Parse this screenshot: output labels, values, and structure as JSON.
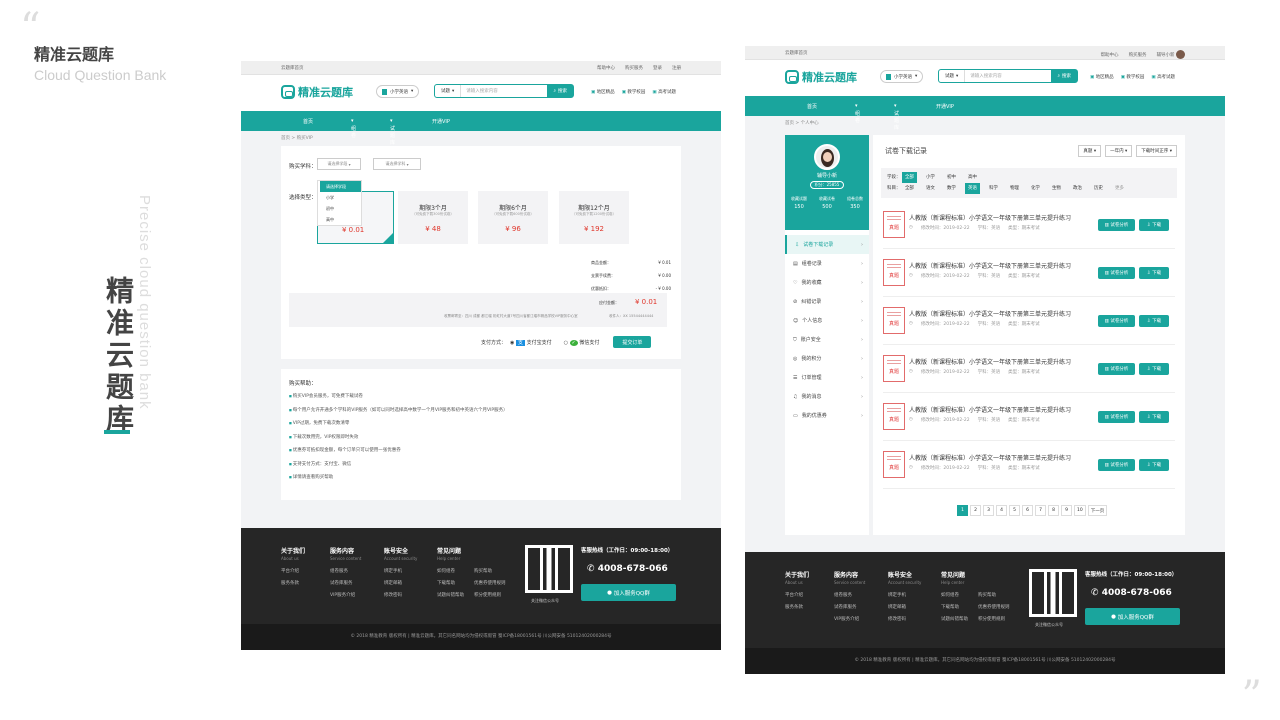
{
  "presentation": {
    "title": "精准云题库",
    "subtitle": "Cloud Question Bank",
    "vertical_en": "Precise cloud question bank",
    "vertical_cn": "精准云题库"
  },
  "page1": {
    "topbar": {
      "left": "云题库首页",
      "right": [
        "帮助中心",
        "购买服务",
        "登录",
        "注册"
      ]
    },
    "logo": "精准云题库",
    "grade_select": "小学英语",
    "search": {
      "type": "试题",
      "placeholder": "请输入搜索内容",
      "button": "搜索"
    },
    "links": [
      "地区精品",
      "教学校园",
      "高考试题"
    ],
    "nav": [
      "首页",
      "组卷",
      "试题库",
      "开通VIP"
    ],
    "crumb": "首页 > 购买VIP",
    "buy": {
      "subject_label": "购买学科：",
      "stage_placeholder": "请选择学段",
      "subject_placeholder": "请选择学科",
      "dropdown": [
        "请选择学段",
        "小学",
        "初中",
        "高中"
      ],
      "type_label": "选择类型：",
      "plans": [
        {
          "name": "期限1个月",
          "note": "",
          "price": "¥ 0.01"
        },
        {
          "name": "期限3个月",
          "note": "（可免费下载300份试卷）",
          "price": "¥ 48"
        },
        {
          "name": "期限6个月",
          "note": "（可免费下载600份试卷）",
          "price": "¥ 96"
        },
        {
          "name": "期限12个月",
          "note": "（可免费下载1200份试卷）",
          "price": "¥ 192"
        }
      ],
      "summary": [
        {
          "k": "商品金额：",
          "v": "¥ 0.01"
        },
        {
          "k": "支票手续费：",
          "v": "¥ 0.00"
        },
        {
          "k": "优惠抵扣：",
          "v": "- ¥ 0.00"
        }
      ],
      "pay_total_label": "应付金额：",
      "pay_total": "¥ 0.01",
      "address": "收票邮寄至：四川 成都 都江堰 彩虹村大道7号四川省都江堰市精品学校VIP服务中心室",
      "receiver": "收件人：XX  15544444444",
      "pay_method_label": "支付方式：",
      "alipay": "支付宝支付",
      "wechat": "微信支付",
      "submit": "提交订单"
    },
    "help": {
      "title": "购买帮助：",
      "items": [
        "购买VIP会员服务，可免费下载试卷",
        "每个用户允许开通多个学科的VIP服务（如可以同时选择高中数学一个月VIP服务和初中英语六个月VIP服务）",
        "VIP过期，免费下载次数清零",
        "下载次数用完，VIP权限即时失效",
        "优惠券可抵扣现金额，每个订单只可以使用一张优惠券",
        "支持支付方式：支付宝、微信",
        "详情请查看购买帮助"
      ]
    }
  },
  "page2": {
    "topbar": {
      "left": "云题库首页",
      "right": [
        "帮助中心",
        "购买服务",
        "辅导小新"
      ]
    },
    "crumb": "首页 > 个人中心",
    "profile": {
      "name": "辅导小新",
      "points": "积分：25855",
      "stats": [
        {
          "k": "收藏试题",
          "v": "150"
        },
        {
          "k": "收藏试卷",
          "v": "500"
        },
        {
          "k": "组卷总数",
          "v": "350"
        }
      ]
    },
    "menu": [
      "试卷下载记录",
      "组卷记录",
      "我的收藏",
      "纠错记录",
      "个人信息",
      "账户安全",
      "我的积分",
      "订单管理",
      "我的消息",
      "我的优惠券"
    ],
    "panel_title": "试卷下载记录",
    "sorts": [
      "真题",
      "一年内",
      "下载时间正序"
    ],
    "filter_stage_label": "学段：",
    "stages": [
      "全部",
      "小学",
      "初中",
      "高中"
    ],
    "filter_subject_label": "科目：",
    "subjects": [
      "全部",
      "语文",
      "数学",
      "英语",
      "科学",
      "物理",
      "化学",
      "生物",
      "政治",
      "历史",
      "更多"
    ],
    "item": {
      "title": "人教版（新课程标准）小学语文一年级下册第三单元提升练习",
      "date": "修改时间：2019-02-22",
      "subject": "学科：英语",
      "type": "类型：期末考试",
      "btn_analyze": "试卷分析",
      "btn_download": "下载",
      "badge": "真题"
    },
    "pages": [
      "1",
      "2",
      "3",
      "4",
      "5",
      "6",
      "7",
      "8",
      "9",
      "10",
      "下一页"
    ]
  },
  "footer": {
    "cols": [
      {
        "h": "关于我们",
        "s": "About us",
        "items": [
          "平台介绍",
          "服务条款"
        ]
      },
      {
        "h": "服务内容",
        "s": "Service content",
        "items": [
          "组卷服务",
          "试卷库服务",
          "VIP服务介绍"
        ]
      },
      {
        "h": "账号安全",
        "s": "Account security",
        "items": [
          "绑定手机",
          "绑定邮箱",
          "修改密码"
        ]
      },
      {
        "h": "常见问题",
        "s": "Help center",
        "items": [
          "如何组卷",
          "下载帮助",
          "试题纠错帮助"
        ]
      }
    ],
    "col4b": [
      "购买帮助",
      "优惠券使用规则",
      "积分使用规则"
    ],
    "qr_caption": "关注微信公众号",
    "hotline": "客服热线（工作日：09:00-18:00）",
    "phone": "4008-678-066",
    "qq": "加入服务QQ群",
    "copyright": "© 2018 精准教育 版权所有 | 精准云题库。其它同名网站均为侵权或假冒 蜀ICP备18001561号 川公网安备 51012402000284号"
  }
}
